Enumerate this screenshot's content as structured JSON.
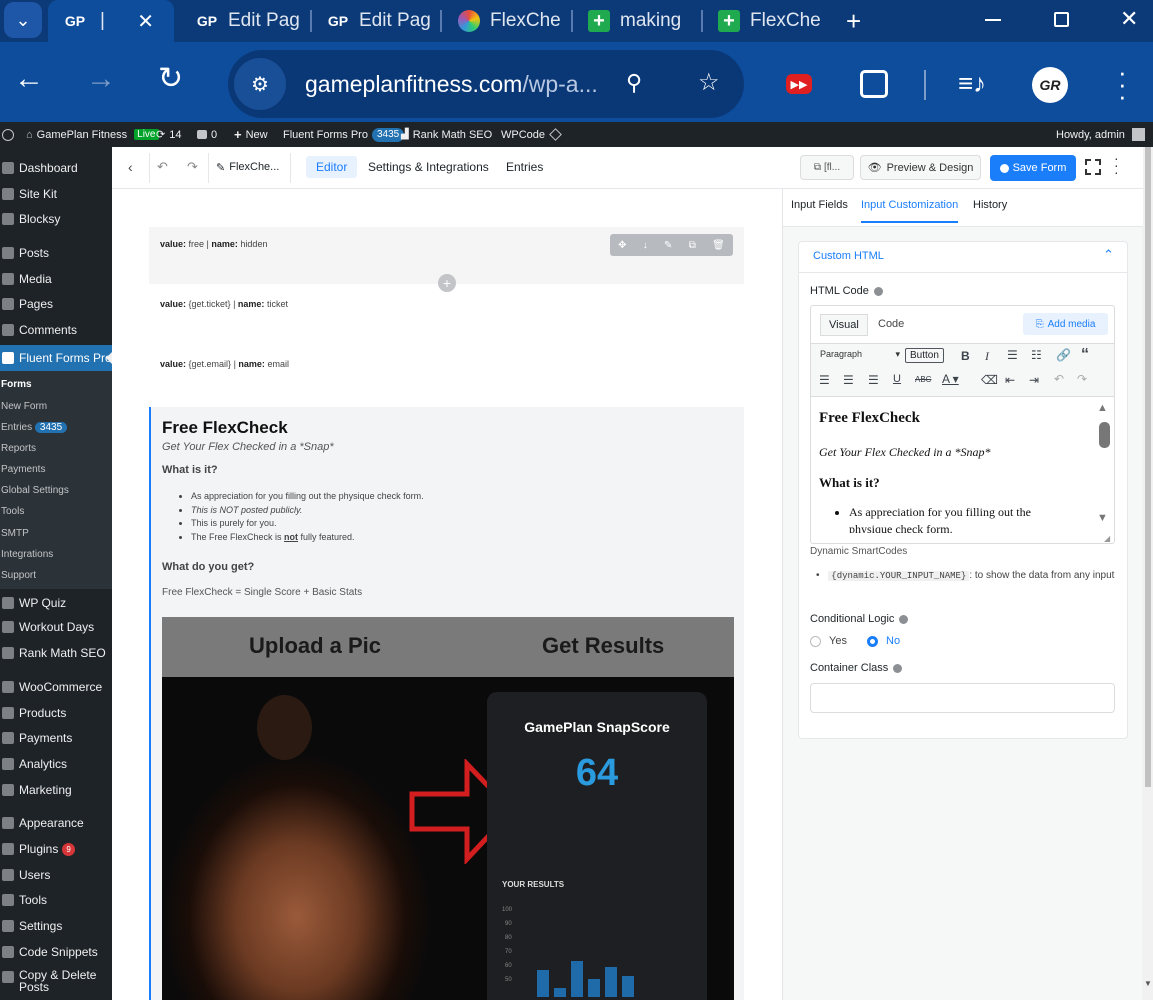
{
  "browser": {
    "tabs": [
      {
        "label": "",
        "favicon": "GP"
      },
      {
        "label": "Edit Pag",
        "favicon": "GP"
      },
      {
        "label": "Edit Pag",
        "favicon": "GP"
      },
      {
        "label": "FlexChe",
        "favicon": "colorful-pinwheel"
      },
      {
        "label": "making",
        "favicon": "green-plus"
      },
      {
        "label": "FlexChe",
        "favicon": "green-plus"
      }
    ],
    "url_domain": "gameplanfitness.com",
    "url_rest": "/wp-a...",
    "profile_initials": "GR"
  },
  "adminbar": {
    "site": "GamePlan Fitness",
    "live": "Live",
    "updates": "14",
    "comments": "0",
    "new": "New",
    "fluent": "Fluent Forms Pro",
    "fluent_count": "3435",
    "rankmath": "Rank Math SEO",
    "wpcode": "WPCode",
    "howdy": "Howdy, admin"
  },
  "sidebar": {
    "items": [
      "Dashboard",
      "Site Kit",
      "Blocksy",
      "Posts",
      "Media",
      "Pages",
      "Comments",
      "Fluent Forms Pro"
    ],
    "submenu": [
      "Forms",
      "New Form",
      "Entries",
      "Reports",
      "Payments",
      "Global Settings",
      "Tools",
      "SMTP",
      "Integrations",
      "Support"
    ],
    "entries_count": "3435",
    "items2": [
      "WP Quiz",
      "Workout Days",
      "Rank Math SEO",
      "WooCommerce",
      "Products",
      "Payments",
      "Analytics",
      "Marketing",
      "Appearance",
      "Plugins",
      "Users",
      "Tools",
      "Settings",
      "Code Snippets",
      "Copy & Delete Posts"
    ],
    "plugins_count": "9"
  },
  "topbar": {
    "form_name": "FlexChe...",
    "tabs": [
      "Editor",
      "Settings & Integrations",
      "Entries"
    ],
    "shortcode": "[fl...",
    "preview": "Preview & Design",
    "save": "Save Form"
  },
  "fields": [
    {
      "value_label": "value:",
      "value": "free",
      "name_label": "name:",
      "name": "hidden"
    },
    {
      "value_label": "value:",
      "value": "{get.ticket}",
      "name_label": "name:",
      "name": "ticket"
    },
    {
      "value_label": "value:",
      "value": "{get.email}",
      "name_label": "name:",
      "name": "email"
    }
  ],
  "html_block": {
    "title": "Free FlexCheck",
    "subtitle": "Get Your Flex Checked in a *Snap*",
    "q1": "What is it?",
    "bullets": [
      "As appreciation for you filling out the physique check form.",
      "This is NOT posted publicly.",
      "This is purely for you."
    ],
    "bullet4_pre": "The Free FlexCheck is ",
    "bullet4_bold": "not",
    "bullet4_post": " fully featured.",
    "q2": "What do you get?",
    "answer": "Free FlexCheck = Single Score + Basic Stats",
    "image": {
      "left_heading": "Upload a Pic",
      "right_heading": "Get Results",
      "card_title": "GamePlan SnapScore",
      "score": "64",
      "results_label": "YOUR RESULTS",
      "axis_ticks": [
        "100",
        "90",
        "80",
        "70",
        "60",
        "50"
      ],
      "bars": [
        0.45,
        0.15,
        0.6,
        0.3,
        0.5,
        0.35
      ]
    }
  },
  "panel": {
    "tabs": [
      "Input Fields",
      "Input Customization",
      "History"
    ],
    "section": "Custom HTML",
    "html_code_label": "HTML Code",
    "editor_tabs": [
      "Visual",
      "Code"
    ],
    "add_media": "Add media",
    "paragraph": "Paragraph",
    "button": "Button",
    "preview_title": "Free FlexCheck",
    "preview_sub": "Get Your Flex Checked in a *Snap*",
    "preview_q": "What is it?",
    "preview_bullet": "As appreciation for you filling out the",
    "preview_bullet2": "physique check form.",
    "smartcodes_label": "Dynamic SmartCodes",
    "smartcode": "{dynamic.YOUR_INPUT_NAME}",
    "smartcode_desc": ": to show the data from any input",
    "cond_label": "Conditional Logic",
    "yes": "Yes",
    "no": "No",
    "container_label": "Container Class",
    "container_value": ""
  },
  "colors": {
    "accent": "#1a7efb",
    "wp_dark": "#1d2327",
    "chrome_tab": "#0c3a79",
    "chrome_bar": "#0d4d9b"
  }
}
